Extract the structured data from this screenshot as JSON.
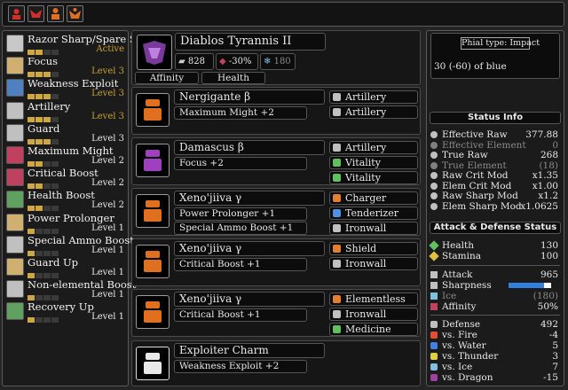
{
  "topbar": {
    "icons": [
      {
        "name": "armor-set-icon-1",
        "color": "#d0302c"
      },
      {
        "name": "armor-set-icon-2",
        "color": "#d0302c"
      },
      {
        "name": "armor-set-icon-3",
        "color": "#e07020"
      },
      {
        "name": "armor-set-icon-4",
        "color": "#e07020"
      }
    ]
  },
  "skills": [
    {
      "name": "Razor Sharp/Spare Shot",
      "level": "Active",
      "pips": [
        1,
        1,
        0,
        0
      ],
      "color": "#c8c8c8",
      "level_color": "#c8a030"
    },
    {
      "name": "Focus",
      "level": "Level 3",
      "pips": [
        1,
        1,
        1,
        0
      ],
      "color": "#d0b070",
      "level_color": "#c8a030"
    },
    {
      "name": "Weakness Exploit",
      "level": "Level 3",
      "pips": [
        1,
        1,
        1,
        0
      ],
      "color": "#5080c0",
      "level_color": "#c8a030"
    },
    {
      "name": "Artillery",
      "level": "Level 3",
      "pips": [
        1,
        1,
        1,
        0
      ],
      "color": "#c0c0c0",
      "level_color": "#c8a030"
    },
    {
      "name": "Guard",
      "level": "Level 3",
      "pips": [
        1,
        1,
        1,
        0
      ],
      "color": "#c0c0c0",
      "level_color": "#e8e8e8"
    },
    {
      "name": "Maximum Might",
      "level": "Level 2",
      "pips": [
        1,
        1,
        0,
        0
      ],
      "color": "#c04060",
      "level_color": "#e8e8e8"
    },
    {
      "name": "Critical Boost",
      "level": "Level 2",
      "pips": [
        1,
        1,
        0,
        0
      ],
      "color": "#c04060",
      "level_color": "#e8e8e8"
    },
    {
      "name": "Health Boost",
      "level": "Level 2",
      "pips": [
        1,
        1,
        0,
        0
      ],
      "color": "#60a060",
      "level_color": "#e8e8e8"
    },
    {
      "name": "Power Prolonger",
      "level": "Level 1",
      "pips": [
        1,
        0,
        0,
        0
      ],
      "color": "#d0b070",
      "level_color": "#e8e8e8"
    },
    {
      "name": "Special Ammo Boost",
      "level": "Level 1",
      "pips": [
        1,
        0,
        0,
        0
      ],
      "color": "#c0c0c0",
      "level_color": "#e8e8e8"
    },
    {
      "name": "Guard Up",
      "level": "Level 1",
      "pips": [
        1,
        0,
        0,
        0
      ],
      "color": "#d0b070",
      "level_color": "#e8e8e8"
    },
    {
      "name": "Non-elemental Boost",
      "level": "Level 1",
      "pips": [
        1,
        0,
        0,
        0
      ],
      "color": "#c0c0c0",
      "level_color": "#e8e8e8"
    },
    {
      "name": "Recovery Up",
      "level": "Level 1",
      "pips": [
        1,
        0,
        0,
        0
      ],
      "color": "#60a060",
      "level_color": "#e8e8e8"
    }
  ],
  "weapon": {
    "name": "Diablos Tyrannis II",
    "attack": "828",
    "affinity": "-30%",
    "element": "180",
    "affinity_tab": "Affinity",
    "health_tab": "Health"
  },
  "armor": [
    {
      "name": "Nergigante β",
      "skill": "Maximum Might +2",
      "icon_color": "#e07020",
      "decos": [
        {
          "label": "Artillery",
          "color": "#c0c0c0"
        },
        {
          "label": "Artillery",
          "color": "#c0c0c0"
        }
      ]
    },
    {
      "name": "Damascus β",
      "skill": "Focus +2",
      "icon_color": "#a040c0",
      "decos": [
        {
          "label": "Artillery",
          "color": "#c0c0c0"
        },
        {
          "label": "Vitality",
          "color": "#60c060"
        },
        {
          "label": "Vitality",
          "color": "#60c060"
        }
      ]
    },
    {
      "name": "Xeno'jiiva γ",
      "skill": "Power Prolonger +1",
      "skill2": "Special Ammo Boost +1",
      "icon_color": "#e07020",
      "decos": [
        {
          "label": "Charger",
          "color": "#e08030"
        },
        {
          "label": "Tenderizer",
          "color": "#5090e0"
        },
        {
          "label": "Ironwall",
          "color": "#c0c0c0"
        }
      ]
    },
    {
      "name": "Xeno'jiiva γ",
      "skill": "Critical Boost +1",
      "icon_color": "#e07020",
      "decos": [
        {
          "label": "Shield",
          "color": "#e08030"
        },
        {
          "label": "Ironwall",
          "color": "#c0c0c0"
        }
      ]
    },
    {
      "name": "Xeno'jiiva γ",
      "skill": "Critical Boost +1",
      "icon_color": "#e07020",
      "decos": [
        {
          "label": "Elementless",
          "color": "#e08030"
        },
        {
          "label": "Ironwall",
          "color": "#c0c0c0"
        },
        {
          "label": "Medicine",
          "color": "#60c060"
        }
      ]
    },
    {
      "name": "Exploiter Charm",
      "skill": "Weakness Exploit +2",
      "icon_color": "#e8e8e8",
      "decos": []
    }
  ],
  "phial": {
    "title": "Phial type: Impact",
    "ammo": "30 (-60) of blue"
  },
  "status_info": {
    "header": "Status Info",
    "rows": [
      {
        "name": "Effective Raw",
        "value": "377.88",
        "dim": false,
        "icon": "#c0c0c0"
      },
      {
        "name": "Effective Element",
        "value": "0",
        "dim": true,
        "icon": "#808080"
      },
      {
        "name": "True Raw",
        "value": "268",
        "dim": false,
        "icon": "#c0c0c0"
      },
      {
        "name": "True Element",
        "value": "(18)",
        "dim": true,
        "icon": "#808080"
      },
      {
        "name": "Raw Crit Mod",
        "value": "x1.35",
        "dim": false,
        "icon": "#c0c0c0"
      },
      {
        "name": "Elem Crit Mod",
        "value": "x1.00",
        "dim": false,
        "icon": "#c0c0c0"
      },
      {
        "name": "Raw Sharp Mod",
        "value": "x1.2",
        "dim": false,
        "icon": "#c0c0c0"
      },
      {
        "name": "Elem Sharp Mod",
        "value": "x1.0625",
        "dim": false,
        "icon": "#c0c0c0"
      }
    ]
  },
  "attack_defense": {
    "header": "Attack & Defense Status",
    "vitals": [
      {
        "name": "Health",
        "value": "130",
        "icon": "#60c060"
      },
      {
        "name": "Stamina",
        "value": "100",
        "icon": "#e0c040"
      }
    ],
    "offense": [
      {
        "name": "Attack",
        "value": "965",
        "icon": "#c0c0c0",
        "dim": false
      },
      {
        "name": "Sharpness",
        "value": "",
        "icon": "#c0c0c0",
        "dim": false
      },
      {
        "name": "Ice",
        "value": "(180)",
        "icon": "#80c0e0",
        "dim": true
      },
      {
        "name": "Affinity",
        "value": "50%",
        "icon": "#c04060",
        "dim": false
      }
    ],
    "sharpness_colors": [
      "#3080e0",
      "#3080e0",
      "#3080e0",
      "#3080e0",
      "#3080e0",
      "#3080e0",
      "#3080e0",
      "#3080e0",
      "#3080e0",
      "#3080e0",
      "#ffffff",
      "#ffffff"
    ],
    "defense": [
      {
        "name": "Defense",
        "value": "492",
        "icon": "#c0c0c0"
      },
      {
        "name": "vs. Fire",
        "value": "-4",
        "icon": "#e05030"
      },
      {
        "name": "vs. Water",
        "value": "5",
        "icon": "#4080e0"
      },
      {
        "name": "vs. Thunder",
        "value": "3",
        "icon": "#e0d040"
      },
      {
        "name": "vs. Ice",
        "value": "7",
        "icon": "#80c0e0"
      },
      {
        "name": "vs. Dragon",
        "value": "-15",
        "icon": "#a040a0"
      }
    ]
  }
}
